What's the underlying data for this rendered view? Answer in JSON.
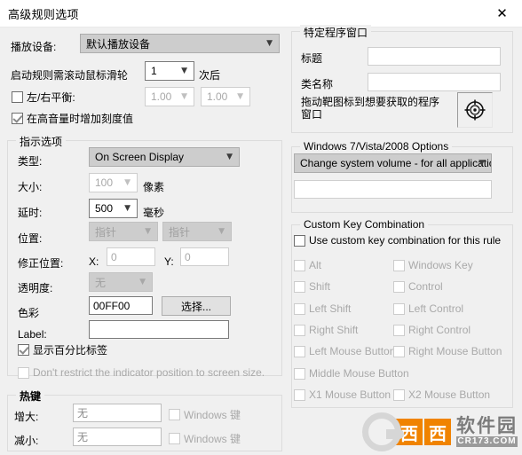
{
  "window": {
    "title": "高级规则选项",
    "close_icon": "close-icon"
  },
  "left": {
    "playback_device_label": "播放设备:",
    "playback_device_value": "默认播放设备",
    "scroll_prefix_label": "启动规则需滚动鼠标滑轮",
    "scroll_count_value": "1",
    "scroll_suffix_label": "次后",
    "balance_checkbox_label": "左/右平衡:",
    "balance_left_value": "1.00",
    "balance_right_value": "1.00",
    "high_volume_checkbox_label": "在高音量时增加刻度值",
    "indicator_group_title": "指示选项",
    "type_label": "类型:",
    "type_value": "On Screen Display",
    "size_label": "大小:",
    "size_value": "100",
    "size_unit": "像素",
    "delay_label": "延时:",
    "delay_value": "500",
    "delay_unit": "毫秒",
    "position_label": "位置:",
    "position_value_1": "指针",
    "position_value_2": "指针",
    "offset_label": "修正位置:",
    "offset_x_label": "X:",
    "offset_x_value": "0",
    "offset_y_label": "Y:",
    "offset_y_value": "0",
    "transparency_label": "透明度:",
    "transparency_value": "无",
    "color_label": "色彩",
    "color_value": "00FF00",
    "color_pick_button": "选择...",
    "label_label": "Label:",
    "label_value": "",
    "show_percent_checkbox_label": "显示百分比标签",
    "dont_restrict_checkbox_label": "Don't restrict the indicator position to screen size.",
    "hotkey_group_title": "热键",
    "increase_label": "增大:",
    "increase_value": "无",
    "increase_win_checkbox_label": "Windows 键",
    "decrease_label": "减小:",
    "decrease_value": "无",
    "decrease_win_checkbox_label": "Windows 键"
  },
  "right": {
    "specific_window_group_title": "特定程序窗口",
    "window_title_label": "标题",
    "window_title_value": "",
    "class_name_label": "类名称",
    "class_name_value": "",
    "drag_hint_line1": "拖动靶图标到想要获取的程序",
    "drag_hint_line2": "窗口",
    "target_icon": "crosshair-target-icon",
    "win_options_group_title": "Windows 7/Vista/2008 Options",
    "win_options_value": "Change system volume - for all applications",
    "win_options_extra_value": "",
    "custom_key_group_title": "Custom Key Combination",
    "use_custom_key_label": "Use custom key combination for this rule",
    "keys": [
      {
        "label": "Alt",
        "checked": false,
        "enabled": false
      },
      {
        "label": "Windows Key",
        "checked": false,
        "enabled": false
      },
      {
        "label": "Shift",
        "checked": false,
        "enabled": false
      },
      {
        "label": "Control",
        "checked": false,
        "enabled": false
      },
      {
        "label": "Left Shift",
        "checked": false,
        "enabled": false
      },
      {
        "label": "Left Control",
        "checked": false,
        "enabled": false
      },
      {
        "label": "Right Shift",
        "checked": false,
        "enabled": false
      },
      {
        "label": "Right Control",
        "checked": false,
        "enabled": false
      },
      {
        "label": "Left Mouse Button",
        "checked": false,
        "enabled": false
      },
      {
        "label": "Right Mouse Button",
        "checked": false,
        "enabled": false
      },
      {
        "label": "Middle Mouse Button",
        "checked": false,
        "enabled": false
      },
      {
        "label": "X1 Mouse Button",
        "checked": false,
        "enabled": false
      },
      {
        "label": "X2 Mouse Button",
        "checked": false,
        "enabled": false
      }
    ]
  },
  "watermark": {
    "logo_letter": "Cr",
    "square_1": "西",
    "square_2": "西",
    "cn_text": "软件园",
    "en_text": "CR173.COM"
  },
  "colors": {
    "dialog_bg": "#f0f0f0",
    "titlebar_bg": "#ffffff",
    "combo_bg": "#cdcdcd",
    "disabled_text": "#a0a0a0",
    "accent_green": "#00FF00",
    "watermark_orange": "#f08300"
  }
}
